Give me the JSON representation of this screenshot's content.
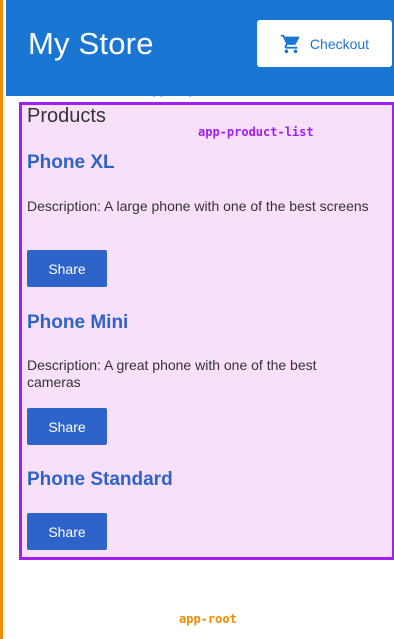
{
  "top_bar": {
    "title": "My Store",
    "checkout_label": "Checkout",
    "checkout_icon": "shopping-cart-icon",
    "tag": "app-top-bar"
  },
  "product_list": {
    "tag": "app-product-list",
    "heading": "Products",
    "products": [
      {
        "name": "Phone XL",
        "description": "Description: A large phone with one of the best screens",
        "share_label": "Share"
      },
      {
        "name": "Phone Mini",
        "description": "Description: A great phone with one of the best cameras",
        "share_label": "Share"
      },
      {
        "name": "Phone Standard",
        "description": "",
        "share_label": "Share"
      }
    ]
  },
  "root": {
    "tag": "app-root"
  },
  "colors": {
    "top_bar_bg": "#1976d2",
    "product_list_border": "#a020f0",
    "product_list_bg": "#f8e0fb",
    "root_border": "#f08a00",
    "accent_blue": "#2e63c9"
  }
}
